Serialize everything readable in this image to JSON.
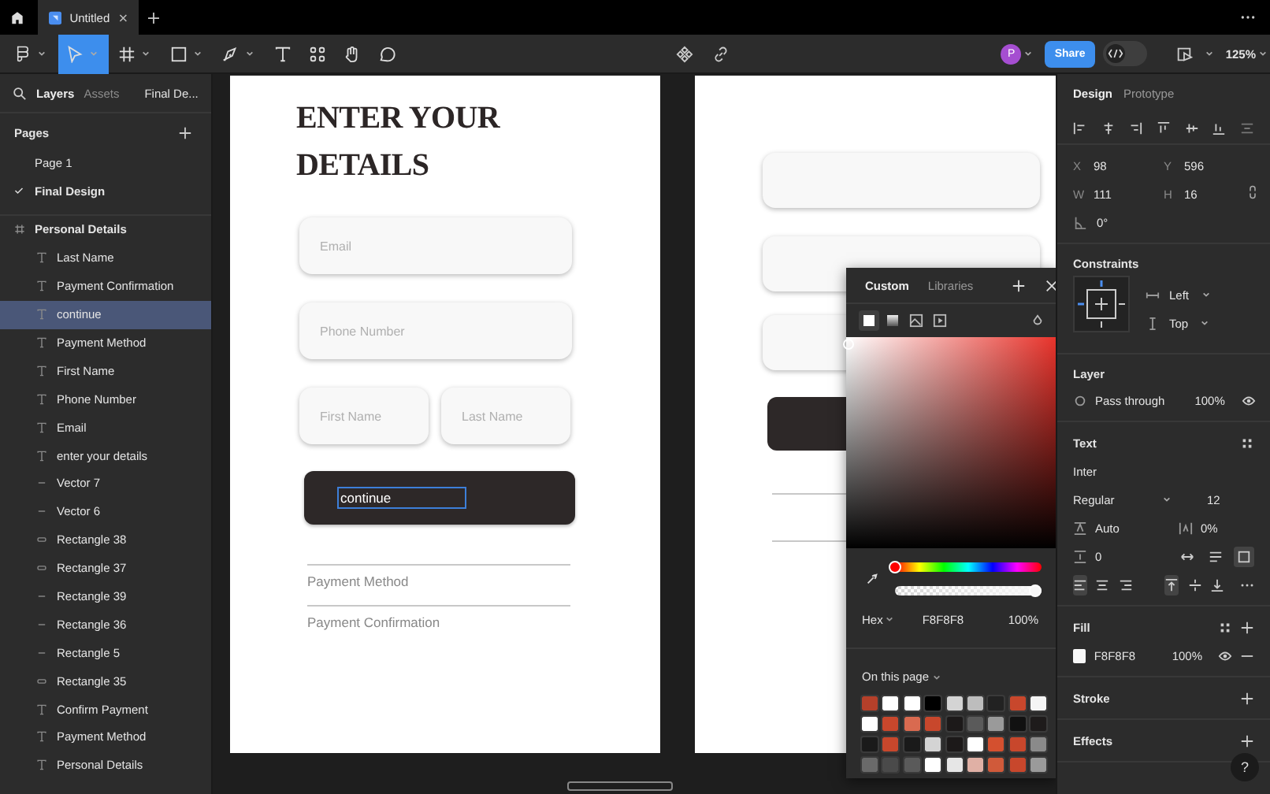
{
  "tabbar": {
    "file_tab": {
      "title": "Untitled",
      "selected": true
    }
  },
  "toolbar": {
    "tools": [
      {
        "kind": "logo",
        "selected": false
      },
      {
        "kind": "move",
        "selected": true
      },
      {
        "kind": "frame",
        "selected": false
      },
      {
        "kind": "shape",
        "selected": false
      },
      {
        "kind": "pen",
        "selected": false
      },
      {
        "kind": "text",
        "selected": false
      },
      {
        "kind": "resources",
        "selected": false
      },
      {
        "kind": "hand",
        "selected": false
      },
      {
        "kind": "comment",
        "selected": false
      }
    ],
    "avatar": "P",
    "share": "Share",
    "dev_mode": {
      "on": false
    },
    "zoom": "125%"
  },
  "left_panel": {
    "tabs": [
      {
        "label": "Layers",
        "selected": true
      },
      {
        "label": "Assets",
        "selected": false
      }
    ],
    "page_menu": "Final De...",
    "pages_title": "Pages",
    "pages": [
      {
        "label": "Page 1",
        "selected": false
      },
      {
        "label": "Final Design",
        "selected": true
      }
    ],
    "layers": [
      {
        "name": "Personal Details",
        "kind": "frame",
        "selected": false,
        "children": [
          {
            "name": "Last Name",
            "kind": "text",
            "selected": false
          },
          {
            "name": "Payment Confirmation",
            "kind": "text",
            "selected": false
          },
          {
            "name": "continue",
            "kind": "text",
            "selected": true
          },
          {
            "name": "Payment Method",
            "kind": "text",
            "selected": false
          },
          {
            "name": "First Name",
            "kind": "text",
            "selected": false
          },
          {
            "name": "Phone Number",
            "kind": "text",
            "selected": false
          },
          {
            "name": "Email",
            "kind": "text",
            "selected": false
          },
          {
            "name": "enter your details",
            "kind": "text",
            "selected": false
          },
          {
            "name": "Vector 7",
            "kind": "line",
            "selected": false
          },
          {
            "name": "Vector 6",
            "kind": "line",
            "selected": false
          },
          {
            "name": "Rectangle 38",
            "kind": "rect",
            "selected": false
          },
          {
            "name": "Rectangle 37",
            "kind": "rect",
            "selected": false
          },
          {
            "name": "Rectangle 39",
            "kind": "line",
            "selected": false
          },
          {
            "name": "Rectangle 36",
            "kind": "line",
            "selected": false
          },
          {
            "name": "Rectangle 5",
            "kind": "line",
            "selected": false
          },
          {
            "name": "Rectangle 35",
            "kind": "rect",
            "selected": false
          },
          {
            "name": "Confirm Payment",
            "kind": "text",
            "selected": false
          },
          {
            "name": "Payment Method",
            "kind": "text",
            "selected": false
          },
          {
            "name": "Personal Details",
            "kind": "text",
            "selected": false
          }
        ]
      }
    ]
  },
  "canvas": {
    "form": {
      "heading": "ENTER YOUR DETAILS",
      "field_rows": [
        [
          {
            "placeholder": "Email"
          }
        ],
        [
          {
            "placeholder": "Phone Number"
          }
        ],
        [
          {
            "placeholder": "First Name"
          },
          {
            "placeholder": "Last Name"
          }
        ]
      ],
      "button": {
        "label": "continue",
        "selected": true
      },
      "links": [
        "Payment Method",
        "Payment Confirmation"
      ]
    }
  },
  "color_picker": {
    "tabs": [
      {
        "label": "Custom",
        "selected": true
      },
      {
        "label": "Libraries",
        "selected": false
      }
    ],
    "fill_types": [
      {
        "kind": "solid",
        "selected": true
      },
      {
        "kind": "gradient",
        "selected": false
      },
      {
        "kind": "image",
        "selected": false
      },
      {
        "kind": "video",
        "selected": false
      }
    ],
    "hue": {
      "level": 0
    },
    "alpha": {
      "level": 1
    },
    "format": "Hex",
    "hex": "F8F8F8",
    "opacity": "100%",
    "swatches_title": "On this page",
    "swatches": [
      {
        "color": "#b5402a"
      },
      {
        "color": "#ffffff"
      },
      {
        "color": "#ffffff"
      },
      {
        "color": "#000000"
      },
      {
        "color": "#d4d4d4"
      },
      {
        "color": "#bdbdbd"
      },
      {
        "color": "#222222"
      },
      {
        "color": "#c8472c"
      },
      {
        "color": "#f5f5f5"
      },
      {
        "color": "#ffffff"
      },
      {
        "color": "#c8472c"
      },
      {
        "color": "#d96a50"
      },
      {
        "color": "#c8472c"
      },
      {
        "color": "#1c1919"
      },
      {
        "color": "#5a5a5a"
      },
      {
        "color": "#9a9a9a"
      },
      {
        "color": "#111111"
      },
      {
        "color": "#1e1b1b"
      },
      {
        "color": "#1a1a1a"
      },
      {
        "color": "#c8472c"
      },
      {
        "color": "#1a1a1a"
      },
      {
        "color": "#d4d4d4"
      },
      {
        "color": "#1c1919"
      },
      {
        "color": "#ffffff"
      },
      {
        "color": "#d4502f"
      },
      {
        "color": "#c8472c"
      },
      {
        "color": "#8a8a8a"
      },
      {
        "color": "#6a6a6a"
      },
      {
        "color": "#4a4a4a"
      },
      {
        "color": "#5a5a5a"
      },
      {
        "color": "#ffffff"
      },
      {
        "color": "#e6e6e6"
      },
      {
        "color": "#e0b0a5"
      },
      {
        "color": "#d05a3a"
      },
      {
        "color": "#c8472c"
      },
      {
        "color": "#9a9a9a"
      }
    ]
  },
  "right_panel": {
    "tabs": [
      {
        "label": "Design",
        "selected": true
      },
      {
        "label": "Prototype",
        "selected": false
      }
    ],
    "position": [
      {
        "label": "X",
        "value": "98"
      },
      {
        "label": "Y",
        "value": "596"
      },
      {
        "label": "W",
        "value": "111"
      },
      {
        "label": "H",
        "value": "16"
      }
    ],
    "rotation": "0°",
    "constraints_title": "Constraints",
    "horizontal": "Left",
    "vertical": "Top",
    "layer_title": "Layer",
    "blend": "Pass through",
    "layer_opacity": "100%",
    "text_title": "Text",
    "font": "Inter",
    "weight": "Regular",
    "size": "12",
    "line_height": "Auto",
    "letter_spacing": "0%",
    "paragraph_spacing": "0",
    "resize": [
      {
        "kind": "auto_width",
        "selected": false
      },
      {
        "kind": "auto_height",
        "selected": false
      },
      {
        "kind": "fixed",
        "selected": true
      }
    ],
    "text_align": [
      {
        "kind": "left",
        "selected": true
      },
      {
        "kind": "center",
        "selected": false
      },
      {
        "kind": "right",
        "selected": false
      }
    ],
    "vertical_align": [
      {
        "kind": "top",
        "selected": true
      },
      {
        "kind": "middle",
        "selected": false
      },
      {
        "kind": "bottom",
        "selected": false
      }
    ],
    "fill_title": "Fill",
    "fill": {
      "hex": "F8F8F8",
      "opacity": "100%",
      "color": "#f8f8f8"
    },
    "stroke_title": "Stroke",
    "effects_title": "Effects",
    "help": "?"
  }
}
